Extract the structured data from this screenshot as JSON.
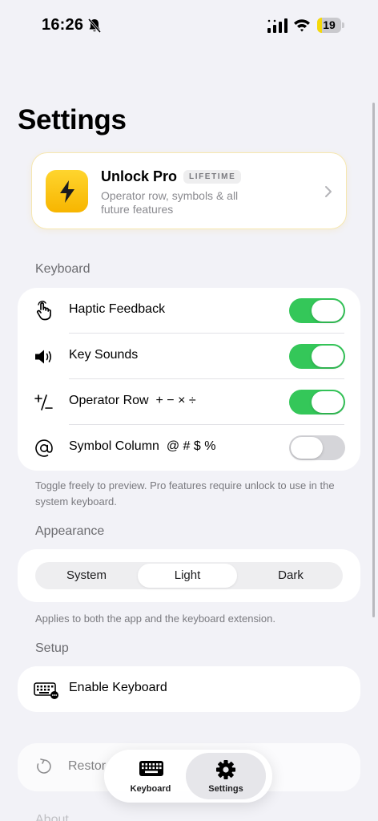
{
  "status_bar": {
    "time": "16:26",
    "battery_level": "19",
    "battery_fraction": 0.19,
    "battery_color": "#f5d90a"
  },
  "page": {
    "title": "Settings"
  },
  "pro_card": {
    "title": "Unlock Pro",
    "badge": "LIFETIME",
    "subtitle": "Operator row, symbols & all future features",
    "icon": "lightning-bolt-icon"
  },
  "keyboard_section": {
    "header": "Keyboard",
    "rows": [
      {
        "label": "Haptic Feedback",
        "icon": "hand-tap-icon",
        "enabled": true
      },
      {
        "label": "Key Sounds",
        "icon": "speaker-icon",
        "enabled": true
      },
      {
        "label": "Operator Row  + − × ÷",
        "icon": "plus-minus-icon",
        "enabled": true
      },
      {
        "label": "Symbol Column  @ # $ %",
        "icon": "at-sign-icon",
        "enabled": false
      }
    ],
    "footnote": "Toggle freely to preview. Pro features require unlock to use in the system keyboard."
  },
  "appearance_section": {
    "header": "Appearance",
    "options": [
      "System",
      "Light",
      "Dark"
    ],
    "selected": "Light",
    "footnote": "Applies to both the app and the keyboard extension."
  },
  "setup_section": {
    "header": "Setup",
    "enable_keyboard_label": "Enable Keyboard"
  },
  "restore_row": {
    "label": "Restor"
  },
  "about_peek": "About",
  "tab_bar": {
    "tabs": [
      {
        "label": "Keyboard",
        "icon": "keyboard-icon",
        "active": false
      },
      {
        "label": "Settings",
        "icon": "gear-icon",
        "active": true
      }
    ]
  },
  "colors": {
    "accent_green": "#34c759",
    "background": "#f2f2f7",
    "pro_gradient_top": "#ffd52e",
    "pro_gradient_bottom": "#f7b500"
  }
}
